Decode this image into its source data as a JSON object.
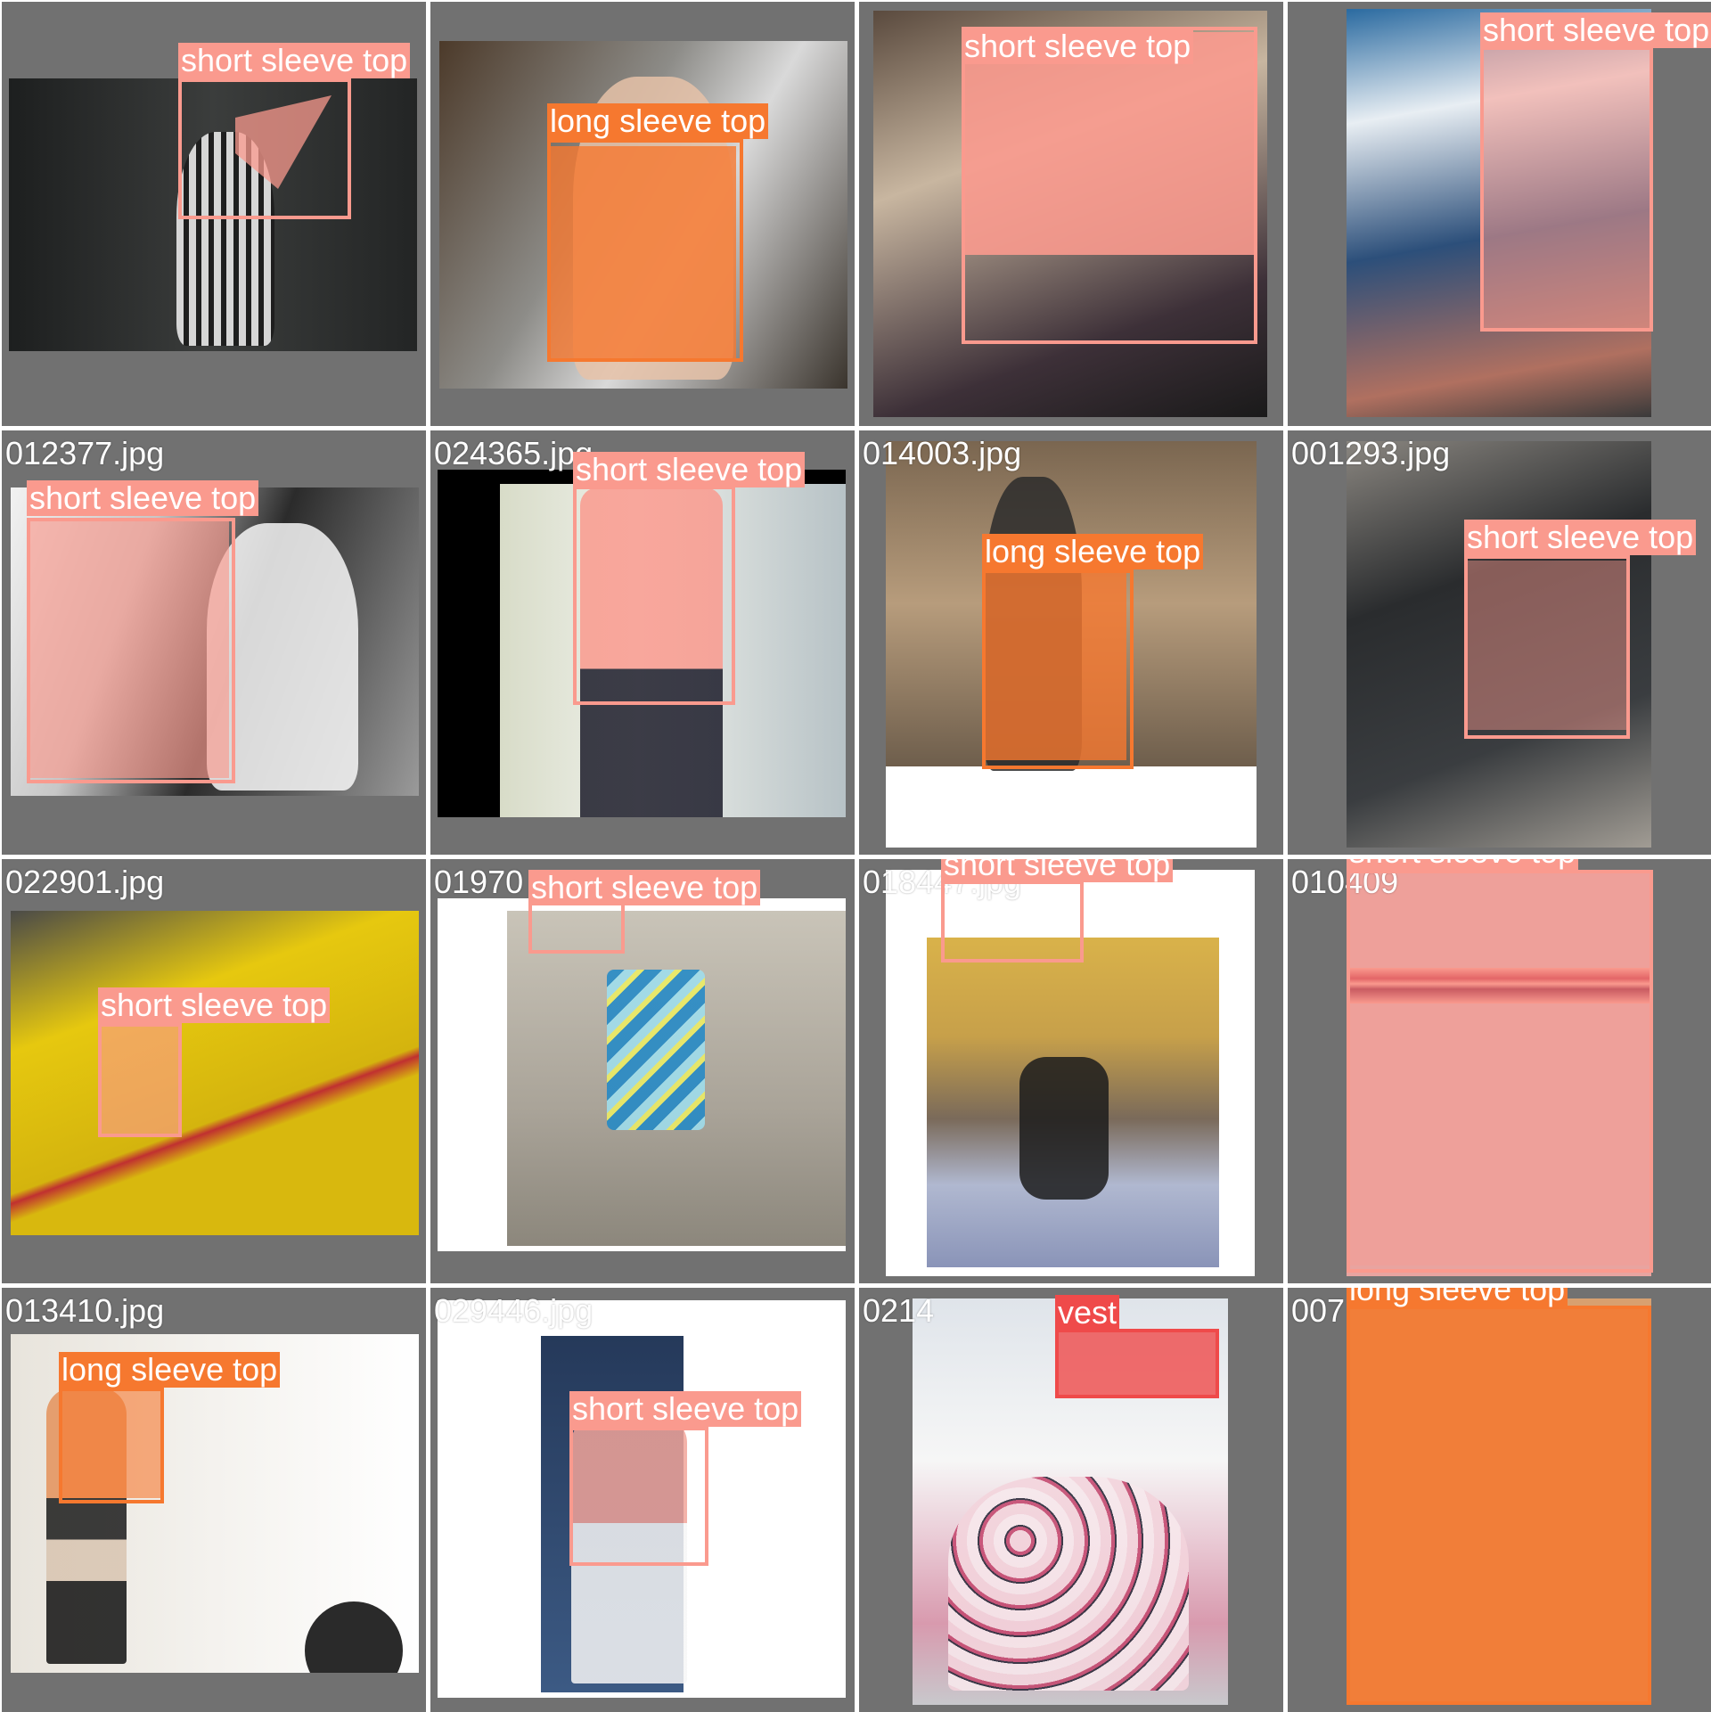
{
  "colors": {
    "short_sleeve_top": "#fa9a8e",
    "long_sleeve_top": "#f6782f",
    "vest": "#ef4a4a",
    "tile_background": "#717171",
    "filename_text": "#ffffff"
  },
  "tiles": [
    {
      "filename": "",
      "detections": [
        {
          "label": "short sleeve top",
          "class": "short_sleeve_top"
        }
      ]
    },
    {
      "filename": "",
      "detections": [
        {
          "label": "long sleeve top",
          "class": "long_sleeve_top"
        }
      ]
    },
    {
      "filename": "",
      "detections": [
        {
          "label": "short sleeve top",
          "class": "short_sleeve_top"
        }
      ]
    },
    {
      "filename": "",
      "detections": [
        {
          "label": "short sleeve top",
          "class": "short_sleeve_top"
        }
      ]
    },
    {
      "filename": "012377.jpg",
      "detections": [
        {
          "label": "short sleeve top",
          "class": "short_sleeve_top"
        }
      ]
    },
    {
      "filename": "024365.jpg",
      "detections": [
        {
          "label": "short sleeve top",
          "class": "short_sleeve_top"
        }
      ]
    },
    {
      "filename": "014003.jpg",
      "detections": [
        {
          "label": "long sleeve top",
          "class": "long_sleeve_top"
        }
      ]
    },
    {
      "filename": "001293.jpg",
      "detections": [
        {
          "label": "short sleeve top",
          "class": "short_sleeve_top"
        }
      ]
    },
    {
      "filename": "022901.jpg",
      "detections": [
        {
          "label": "short sleeve top",
          "class": "short_sleeve_top"
        }
      ]
    },
    {
      "filename": "01970",
      "detections": [
        {
          "label": "short sleeve top",
          "class": "short_sleeve_top"
        }
      ]
    },
    {
      "filename": "018447.jpg",
      "detections": [
        {
          "label": "short sleeve top",
          "class": "short_sleeve_top"
        }
      ]
    },
    {
      "filename": "010409",
      "detections": [
        {
          "label": "short sleeve top",
          "class": "short_sleeve_top"
        }
      ]
    },
    {
      "filename": "013410.jpg",
      "detections": [
        {
          "label": "long sleeve top",
          "class": "long_sleeve_top"
        }
      ]
    },
    {
      "filename": "029446.jpg",
      "detections": [
        {
          "label": "short sleeve top",
          "class": "short_sleeve_top"
        }
      ]
    },
    {
      "filename": "0214",
      "detections": [
        {
          "label": "vest",
          "class": "vest"
        }
      ]
    },
    {
      "filename": "007",
      "detections": [
        {
          "label": "long sleeve top",
          "class": "long_sleeve_top"
        }
      ]
    }
  ]
}
